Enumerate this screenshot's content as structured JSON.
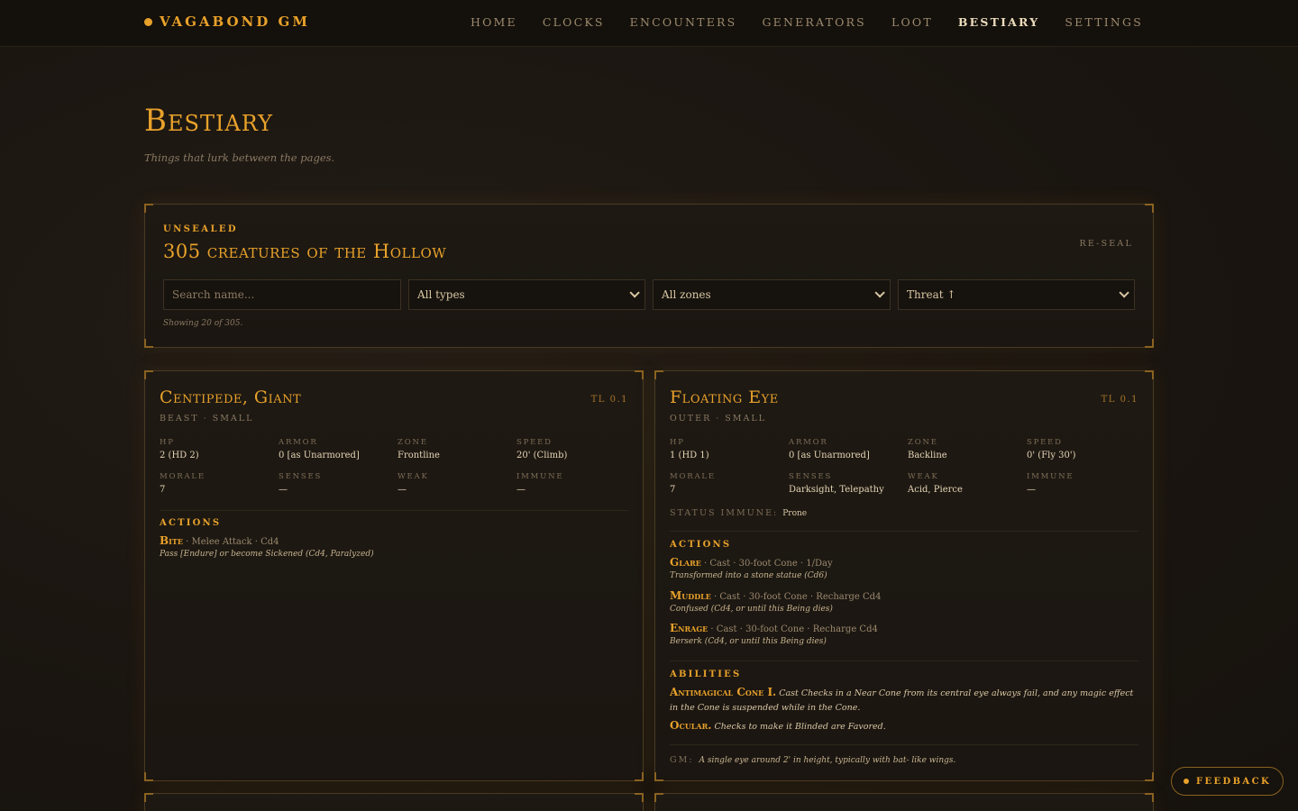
{
  "brand": {
    "name": "VAGABOND GM"
  },
  "nav": [
    {
      "label": "HOME"
    },
    {
      "label": "CLOCKS"
    },
    {
      "label": "ENCOUNTERS"
    },
    {
      "label": "GENERATORS"
    },
    {
      "label": "LOOT"
    },
    {
      "label": "BESTIARY",
      "active": true
    },
    {
      "label": "SETTINGS"
    }
  ],
  "page": {
    "title": "Bestiary",
    "subtitle": "Things that lurk between the pages."
  },
  "filters": {
    "eyebrow": "UNSEALED",
    "heading": "305 creatures of the Hollow",
    "reseal": "RE-SEAL",
    "search_placeholder": "Search name...",
    "type_value": "All types",
    "zone_value": "All zones",
    "sort_value": "Threat ↑",
    "showing": "Showing 20 of 305."
  },
  "creatures": [
    {
      "name": "Centipede, Giant",
      "tl": "TL 0.1",
      "type": "BEAST · SMALL",
      "stats": {
        "hp_label": "HP",
        "hp": "2 (HD 2)",
        "armor_label": "ARMOR",
        "armor": "0 [as Unarmored]",
        "zone_label": "ZONE",
        "zone": "Frontline",
        "speed_label": "SPEED",
        "speed": "20' (Climb)",
        "morale_label": "MORALE",
        "morale": "7",
        "senses_label": "SENSES",
        "senses": "—",
        "weak_label": "WEAK",
        "weak": "—",
        "immune_label": "IMMUNE",
        "immune": "—"
      },
      "actions_label": "ACTIONS",
      "actions": [
        {
          "name": "Bite",
          "detail": " · Melee Attack · Cd4",
          "effect": "Pass [Endure] or become Sickened (Cd4, Paralyzed)"
        }
      ]
    },
    {
      "name": "Floating Eye",
      "tl": "TL 0.1",
      "type": "OUTER · SMALL",
      "stats": {
        "hp_label": "HP",
        "hp": "1 (HD 1)",
        "armor_label": "ARMOR",
        "armor": "0 [as Unarmored]",
        "zone_label": "ZONE",
        "zone": "Backline",
        "speed_label": "SPEED",
        "speed": "0' (Fly 30')",
        "morale_label": "MORALE",
        "morale": "7",
        "senses_label": "SENSES",
        "senses": "Darksight, Telepathy",
        "weak_label": "WEAK",
        "weak": "Acid, Pierce",
        "immune_label": "IMMUNE",
        "immune": "—"
      },
      "status_immune_label": "STATUS IMMUNE:",
      "status_immune": "Prone",
      "actions_label": "ACTIONS",
      "actions": [
        {
          "name": "Glare",
          "detail": " · Cast · 30-foot Cone · 1/Day",
          "effect": "Transformed into a stone statue (Cd6)"
        },
        {
          "name": "Muddle",
          "detail": " · Cast · 30-foot Cone · Recharge Cd4",
          "effect": "Confused (Cd4, or until this Being dies)"
        },
        {
          "name": "Enrage",
          "detail": " · Cast · 30-foot Cone · Recharge Cd4",
          "effect": "Berserk (Cd4, or until this Being dies)"
        }
      ],
      "abilities_label": "ABILITIES",
      "abilities": [
        {
          "name": "Antimagical Cone I.",
          "text": " Cast Checks in a Near Cone from its central eye always fail, and any magic effect in the Cone is suspended while in the Cone."
        },
        {
          "name": "Ocular.",
          "text": " Checks to make it Blinded are Favored."
        }
      ],
      "gm_label": "GM:",
      "gm": "A single eye around 2' in height, typically with bat- like wings."
    }
  ],
  "feedback": {
    "label": "FEEDBACK"
  },
  "colors": {
    "accent": "#e8a12a",
    "background": "#1c1712",
    "text": "#d9c7a3"
  }
}
